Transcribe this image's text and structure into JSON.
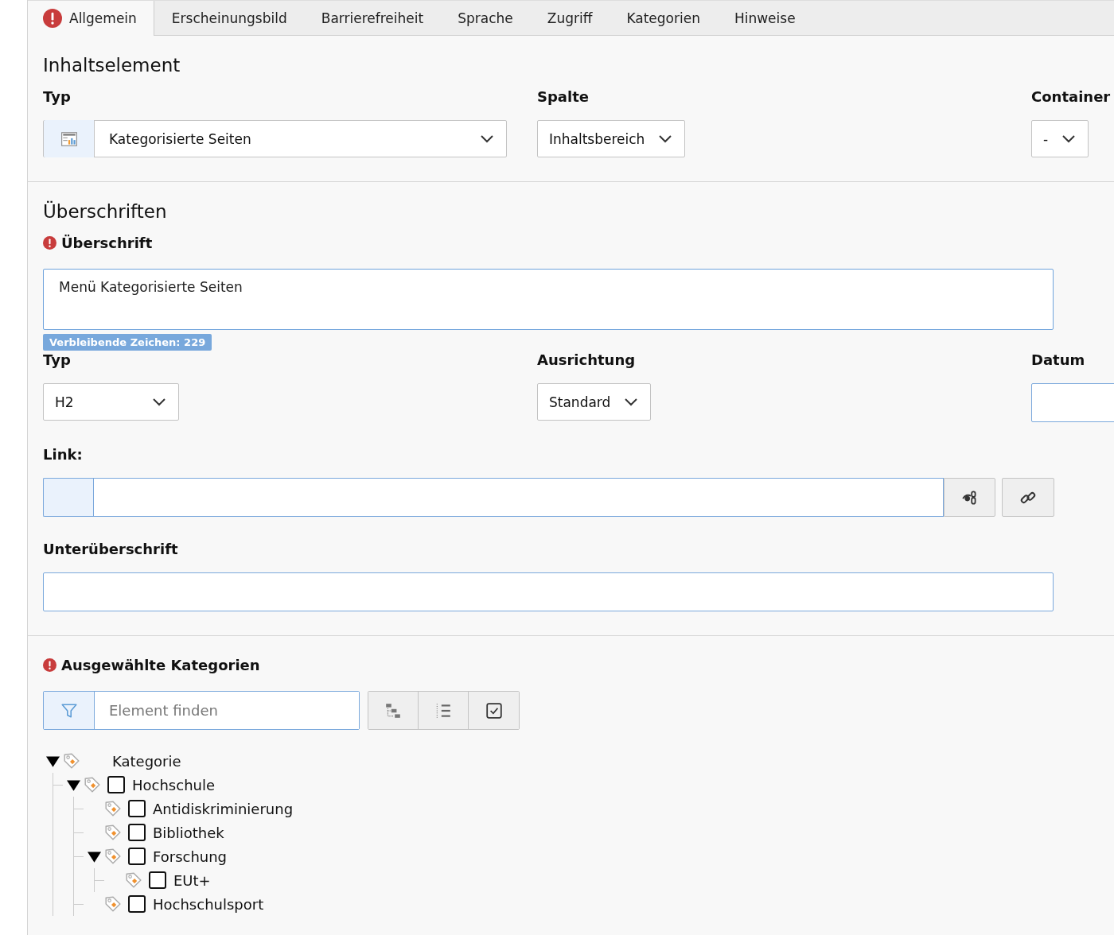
{
  "tabs": [
    {
      "label": "Allgemein",
      "selected": true,
      "error": true
    },
    {
      "label": "Erscheinungsbild",
      "selected": false,
      "error": false
    },
    {
      "label": "Barrierefreiheit",
      "selected": false,
      "error": false
    },
    {
      "label": "Sprache",
      "selected": false,
      "error": false
    },
    {
      "label": "Zugriff",
      "selected": false,
      "error": false
    },
    {
      "label": "Kategorien",
      "selected": false,
      "error": false
    },
    {
      "label": "Hinweise",
      "selected": false,
      "error": false
    }
  ],
  "content_element": {
    "heading": "Inhaltselement",
    "type": {
      "label": "Typ",
      "value": "Kategorisierte Seiten"
    },
    "column": {
      "label": "Spalte",
      "value": "Inhaltsbereich"
    },
    "container": {
      "label": "Container",
      "value": "-"
    }
  },
  "headlines": {
    "heading": "Überschriften",
    "headline": {
      "label": "Überschrift",
      "required": true,
      "value": "Menü Kategorisierte Seiten",
      "remaining": "Verbleibende Zeichen: 229"
    },
    "type": {
      "label": "Typ",
      "value": "H2"
    },
    "alignment": {
      "label": "Ausrichtung",
      "value": "Standard"
    },
    "date": {
      "label": "Datum"
    },
    "link": {
      "label": "Link:"
    },
    "subheadline": {
      "label": "Unterüberschrift"
    }
  },
  "categories": {
    "label": "Ausgewählte Kategorien",
    "required": true,
    "filter": {
      "placeholder": "Element finden"
    },
    "tree": {
      "label": "Kategorie",
      "expanded": true,
      "children": [
        {
          "label": "Hochschule",
          "checked": false,
          "expanded": true,
          "children": [
            {
              "label": "Antidiskriminierung",
              "checked": false
            },
            {
              "label": "Bibliothek",
              "checked": false
            },
            {
              "label": "Forschung",
              "checked": false,
              "expanded": true,
              "children": [
                {
                  "label": "EUt+",
                  "checked": false
                }
              ]
            },
            {
              "label": "Hochschulsport",
              "checked": false
            }
          ]
        }
      ]
    }
  }
}
